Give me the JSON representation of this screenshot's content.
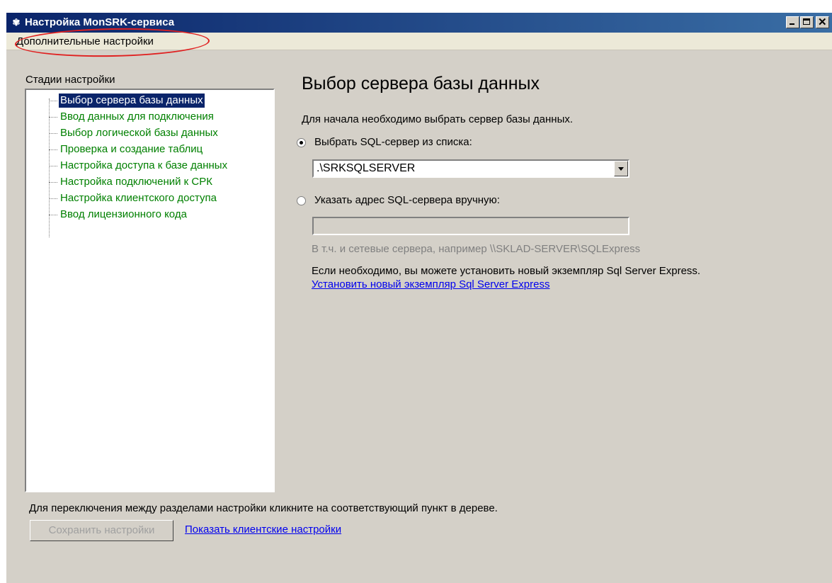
{
  "window": {
    "title": "Настройка MonSRK-сервиса",
    "icon": "app-icon",
    "controls": [
      "minimize-icon",
      "maximize-icon",
      "close-icon"
    ]
  },
  "menu": {
    "items": [
      "Дополнительные настройки"
    ]
  },
  "tree": {
    "label": "Стадии настройки",
    "items": [
      "Выбор сервера базы данных",
      "Ввод данных для подключения",
      "Выбор логической базы данных",
      "Проверка и создание таблиц",
      "Настройка доступа к базе данных",
      "Настройка подключений к СРК",
      "Настройка клиентского доступа",
      "Ввод лицензионного кода"
    ],
    "selected_index": 0
  },
  "main": {
    "heading": "Выбор сервера базы данных",
    "intro": "Для начала необходимо выбрать сервер базы данных.",
    "option_list_label": "Выбрать SQL-сервер из списка:",
    "server_value": ".\\SRKSQLSERVER",
    "option_manual_label": "Указать адрес SQL-сервера вручную:",
    "manual_value": "",
    "hint": "В т.ч. и сетевые сервера, например \\\\SKLAD-SERVER\\SQLExpress",
    "express_note": "Если необходимо, вы можете установить новый экземпляр Sql Server Express.",
    "install_link": "Установить новый экземпляр Sql Server Express"
  },
  "footer": {
    "instruction": "Для переключения между разделами настройки кликните на соответствующий пункт в дереве.",
    "save_button": "Сохранить настройки",
    "client_link": "Показать клиентские настройки"
  },
  "colors": {
    "title_start": "#0a246a",
    "title_end": "#3a6ea5",
    "tree_text": "#008000",
    "link": "#0000ee",
    "annotation": "#e02020"
  }
}
